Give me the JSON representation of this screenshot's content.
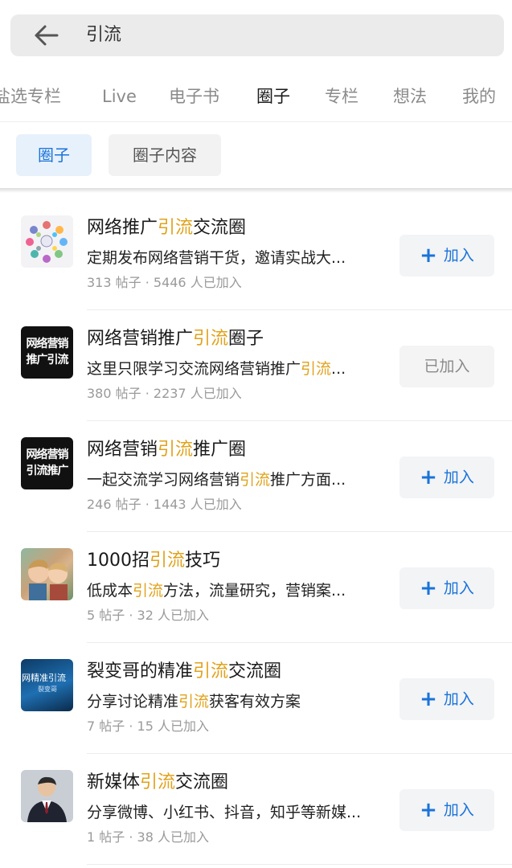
{
  "search": {
    "query": "引流"
  },
  "tabs": [
    {
      "label": "盐选专栏",
      "active": false
    },
    {
      "label": "Live",
      "active": false
    },
    {
      "label": "电子书",
      "active": false
    },
    {
      "label": "圈子",
      "active": true
    },
    {
      "label": "专栏",
      "active": false
    },
    {
      "label": "想法",
      "active": false
    },
    {
      "label": "我的",
      "active": false
    }
  ],
  "filters": [
    {
      "label": "圈子",
      "active": true
    },
    {
      "label": "圈子内容",
      "active": false
    }
  ],
  "results": [
    {
      "title_pre": "网络推广",
      "title_hl": "引流",
      "title_post": "交流圈",
      "desc_pre": "定期发布网络营销干货，邀请实战大...",
      "desc_hl": "",
      "desc_post": "",
      "meta": "313 帖子 · 5446 人已加入",
      "button": "加入",
      "joined": false,
      "avatar": "network-graphic"
    },
    {
      "title_pre": "网络营销推广",
      "title_hl": "引流",
      "title_post": "圈子",
      "desc_pre": "这里只限学习交流网络营销推广",
      "desc_hl": "引流",
      "desc_post": "...",
      "meta": "380 帖子 · 2237 人已加入",
      "button": "已加入",
      "joined": true,
      "avatar": "text-logo",
      "avatar_lines": [
        "网络营销",
        "推广引流"
      ]
    },
    {
      "title_pre": "网络营销",
      "title_hl": "引流",
      "title_post": "推广圈",
      "desc_pre": "一起交流学习网络营销",
      "desc_hl": "引流",
      "desc_post": "推广方面...",
      "meta": "246 帖子 · 1443 人已加入",
      "button": "加入",
      "joined": false,
      "avatar": "text-logo",
      "avatar_lines": [
        "网络营销",
        "引流推广"
      ]
    },
    {
      "title_pre": "1000招",
      "title_hl": "引流",
      "title_post": "技巧",
      "desc_pre": "低成本",
      "desc_hl": "引流",
      "desc_post": "方法，流量研究，营销案...",
      "meta": "5 帖子 · 32 人已加入",
      "button": "加入",
      "joined": false,
      "avatar": "photo-kids"
    },
    {
      "title_pre": "裂变哥的精准",
      "title_hl": "引流",
      "title_post": "交流圈",
      "desc_pre": "分享讨论精准",
      "desc_hl": "引流",
      "desc_post": "获客有效方案",
      "meta": "7 帖子 · 15 人已加入",
      "button": "加入",
      "joined": false,
      "avatar": "blue-banner",
      "avatar_lines": [
        "网精准引流",
        "裂变哥"
      ]
    },
    {
      "title_pre": "新媒体",
      "title_hl": "引流",
      "title_post": "交流圈",
      "desc_pre": "分享微博、小红书、抖音，知乎等新媒...",
      "desc_hl": "",
      "desc_post": "",
      "meta": "1 帖子 · 38 人已加入",
      "button": "加入",
      "joined": false,
      "avatar": "photo-man"
    }
  ]
}
